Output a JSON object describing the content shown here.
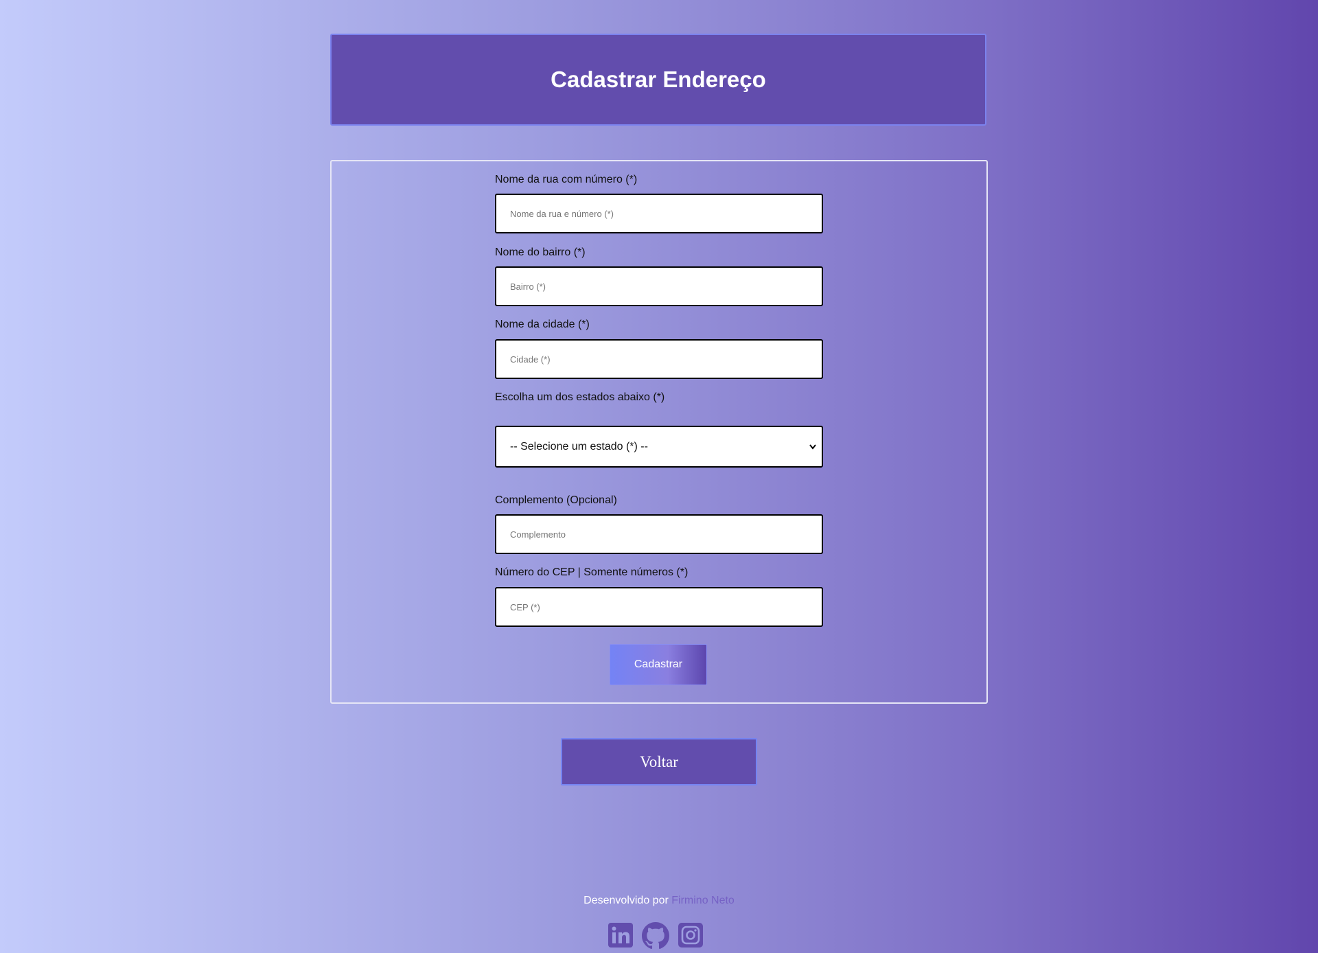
{
  "header": {
    "title": "Cadastrar Endereço"
  },
  "form": {
    "street": {
      "label": "Nome da rua com número (*)",
      "placeholder": "Nome da rua e número (*)",
      "value": ""
    },
    "neighborhood": {
      "label": "Nome do bairro (*)",
      "placeholder": "Bairro (*)",
      "value": ""
    },
    "city": {
      "label": "Nome da cidade (*)",
      "placeholder": "Cidade (*)",
      "value": ""
    },
    "state": {
      "label": "Escolha um dos estados abaixo (*)",
      "selected": "-- Selecione um estado (*) --"
    },
    "complement": {
      "label": "Complemento (Opcional)",
      "placeholder": "Complemento",
      "value": ""
    },
    "cep": {
      "label": "Número do CEP | Somente números (*)",
      "placeholder": "CEP (*)",
      "value": ""
    },
    "submit_label": "Cadastrar"
  },
  "back_label": "Voltar",
  "footer": {
    "credit_prefix": "Desenvolvido por ",
    "author": "Firmino Neto",
    "social": [
      {
        "icon": "linkedin-icon"
      },
      {
        "icon": "github-icon"
      },
      {
        "icon": "instagram-icon"
      }
    ]
  },
  "colors": {
    "primary": "#624dad",
    "accent_border": "#7b82ee",
    "link": "#7662c5",
    "gradient_start": "#c3cbfb",
    "gradient_end": "#6146ad"
  }
}
